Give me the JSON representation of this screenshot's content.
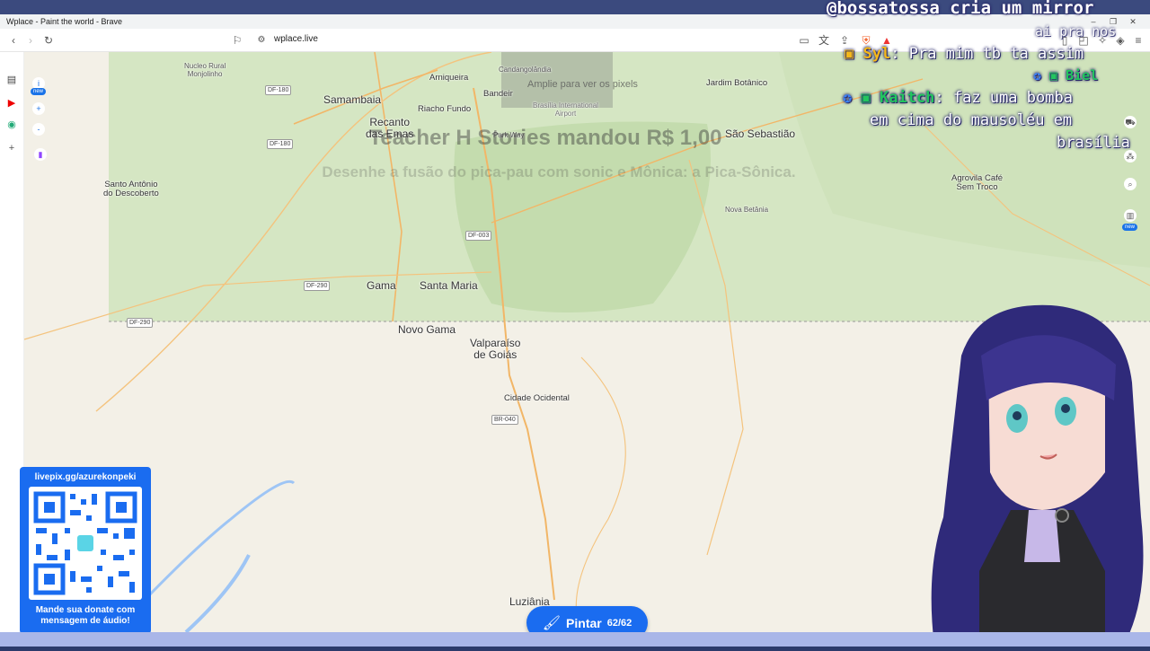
{
  "browser": {
    "window_title": "Wplace - Paint the world - Brave",
    "url": "wplace.live",
    "brand_color": "#1a6cf0"
  },
  "sidebar": {
    "items": [
      {
        "icon": "panel-icon"
      },
      {
        "icon": "youtube-icon"
      },
      {
        "icon": "wplace-icon"
      },
      {
        "icon": "add-icon"
      }
    ]
  },
  "map": {
    "zoom_hint": "Amplie para ver os pixels",
    "controls": {
      "new_badge": "new",
      "zoom_in": "+",
      "zoom_out": "-"
    },
    "places": {
      "samambaia": "Samambaia",
      "recanto": "Recanto\ndas Emas",
      "riacho": "Riacho Fundo",
      "arniqueira": "Arniqueira",
      "nucleo_rural": "Nucleo Rural\nMonjolinho",
      "santo_antonio": "Santo Antônio\ndo Descoberto",
      "gama": "Gama",
      "santa_maria": "Santa Maria",
      "novo_gama": "Novo Gama",
      "valparaiso": "Valparaíso\nde Goiás",
      "cidade_ocidental": "Cidade Ocidental",
      "luziania": "Luziânia",
      "jardim_botanico": "Jardim Botânico",
      "sao_sebastiao": "São Sebastião",
      "nova_betania": "Nova Betânia",
      "agrovila": "Agrovila Café\nSem Troco",
      "park_way": "Park Way",
      "airport": "Brasília International\nAirport",
      "candangolandia": "Candangolândia",
      "bandeirante": "Bandeir"
    },
    "roads": {
      "df180a": "DF-180",
      "df180b": "DF-180",
      "df003": "DF-003",
      "df290a": "DF-290",
      "df290b": "DF-290",
      "br040": "BR-040"
    }
  },
  "paint_button": {
    "label": "Pintar",
    "count": "62/62"
  },
  "donation": {
    "title": "Teacher H Stories mandou R$ 1,00",
    "message": "Desenhe a fusão do pica-pau com sonic e Mônica: a Pica-Sônica."
  },
  "qr_panel": {
    "url": "livepix.gg/azurekonpeki",
    "caption_line1": "Mande sua donate com",
    "caption_line2": "mensagem de áudio!"
  },
  "chat": {
    "line1": "@bossatossa cria um mirror",
    "line2": "ai pra nos",
    "msg1_name": "Syl",
    "msg1_text": ": Pra mim tb ta assim",
    "msg2_name": "Biel",
    "msg3_name": "Kaitch",
    "msg3_text": ": faz uma bomba",
    "msg3_line2": "em cima do mausoléu em",
    "msg3_line3": "brasília"
  }
}
